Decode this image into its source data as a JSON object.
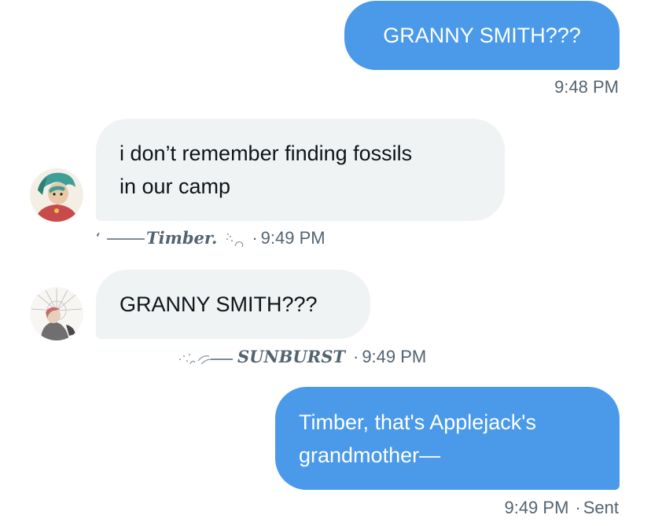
{
  "messages": [
    {
      "id": "m1",
      "direction": "outgoing",
      "text": "GRANNY SMITH???",
      "time": "9:48 PM"
    },
    {
      "id": "m2",
      "direction": "incoming",
      "line1": "i don’t remember finding fossils",
      "line2": "in our camp",
      "sender_signature": "Timber.",
      "sep": "·",
      "time": "9:49 PM",
      "avatar_icon": "character-avatar-green-hair"
    },
    {
      "id": "m3",
      "direction": "incoming",
      "text": "GRANNY SMITH???",
      "sender_signature": "SUNBURST",
      "sep": "·",
      "time": "9:49 PM",
      "avatar_icon": "character-avatar-sunburst"
    },
    {
      "id": "m4",
      "direction": "outgoing",
      "line1": "Timber, that's Applejack's",
      "line2": "grandmother—",
      "time": "9:49 PM",
      "sep": "·",
      "status": "Sent"
    }
  ],
  "colors": {
    "outgoing_bubble": "#4a9ae9",
    "incoming_bubble": "#eff3f4",
    "meta_text": "#536471"
  }
}
